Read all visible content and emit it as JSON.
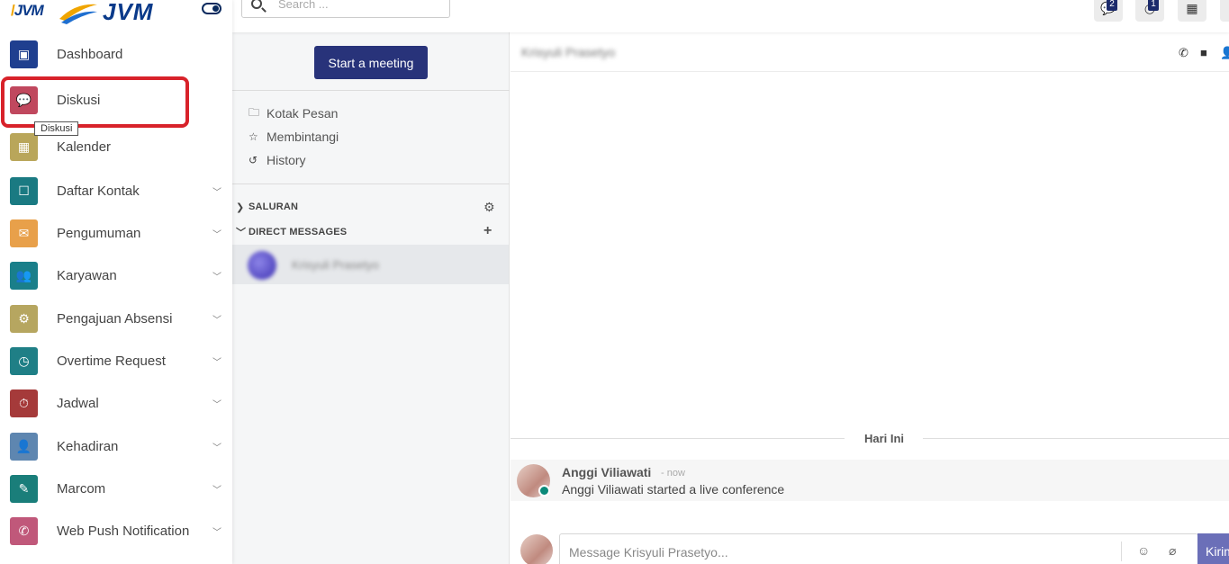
{
  "brand": {
    "mini": "JVM",
    "name": "JVM"
  },
  "search": {
    "placeholder": "Search ..."
  },
  "topbar": {
    "badges": [
      "2",
      "1"
    ]
  },
  "sidebar": {
    "tooltip": "Diskusi",
    "items": [
      {
        "label": "Dashboard",
        "color": "#1f3f8f",
        "caret": false
      },
      {
        "label": "Diskusi",
        "color": "#c0485e",
        "caret": false
      },
      {
        "label": "Kalender",
        "color": "#b9a65a",
        "caret": false
      },
      {
        "label": "Daftar Kontak",
        "color": "#1a7a82",
        "caret": true
      },
      {
        "label": "Pengumuman",
        "color": "#e8a04a",
        "caret": true
      },
      {
        "label": "Karyawan",
        "color": "#1a7f8a",
        "caret": true
      },
      {
        "label": "Pengajuan Absensi",
        "color": "#b6a660",
        "caret": true
      },
      {
        "label": "Overtime Request",
        "color": "#1f7f86",
        "caret": true
      },
      {
        "label": "Jadwal",
        "color": "#a53a3a",
        "caret": true
      },
      {
        "label": "Kehadiran",
        "color": "#5e86b0",
        "caret": true
      },
      {
        "label": "Marcom",
        "color": "#1a7e7a",
        "caret": true
      },
      {
        "label": "Web Push Notification",
        "color": "#c0587a",
        "caret": true
      }
    ]
  },
  "discuss": {
    "meeting_button": "Start a meeting",
    "mailboxes": [
      "Kotak Pesan",
      "Membintangi",
      "History"
    ],
    "channels_label": "SALURAN",
    "dm_label": "DIRECT MESSAGES",
    "dm_name": "Krisyuli Prasetyo"
  },
  "thread": {
    "title": "Krisyuli Prasetyo",
    "day_separator": "Hari Ini",
    "message": {
      "author": "Anggi Viliawati",
      "time": "- now",
      "body": "Anggi Viliawati started a live conference"
    },
    "composer": {
      "placeholder": "Message Krisyuli Prasetyo...",
      "send_label": "Kirim"
    }
  }
}
